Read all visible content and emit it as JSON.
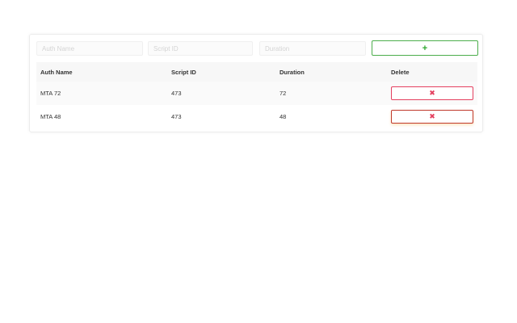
{
  "form": {
    "auth_placeholder": "Auth Name",
    "script_placeholder": "Script ID",
    "duration_placeholder": "Duration",
    "add_label": "+"
  },
  "table": {
    "headers": [
      "Auth Name",
      "Script ID",
      "Duration",
      "Delete"
    ],
    "rows": [
      {
        "auth": "MTA 72",
        "script": "473",
        "duration": "72",
        "delete_label": "✖"
      },
      {
        "auth": "MTA 48",
        "script": "473",
        "duration": "48",
        "delete_label": "✖"
      }
    ]
  },
  "colors": {
    "add_accent": "#4cae4c",
    "delete_accent": "#e4405f"
  }
}
